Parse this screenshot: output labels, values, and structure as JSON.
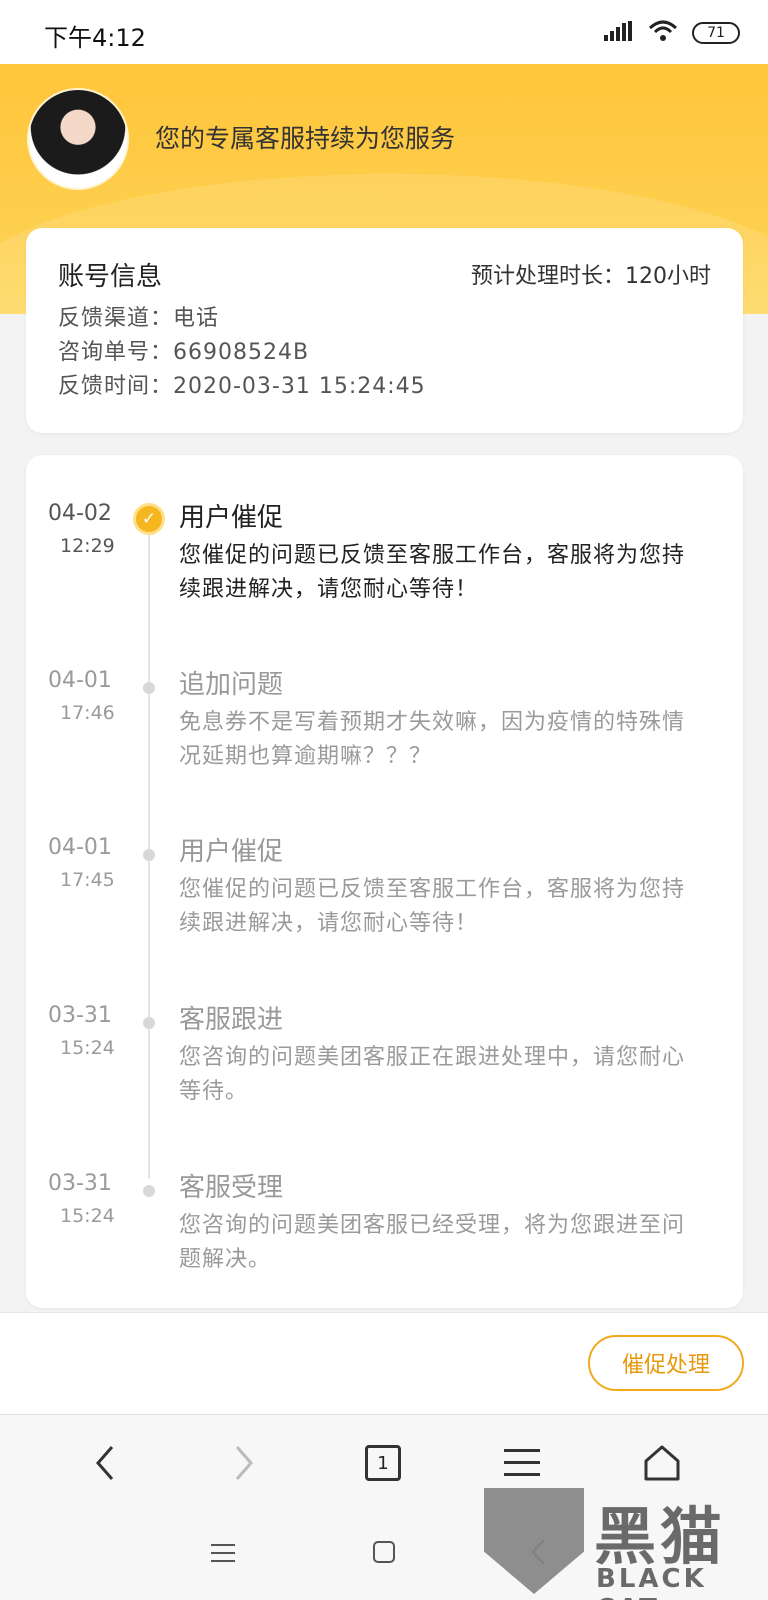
{
  "status_bar": {
    "time": "下午4:12",
    "battery": "71"
  },
  "header": {
    "title": "您的专属客服持续为您服务"
  },
  "account": {
    "title": "账号信息",
    "eta": "预计处理时长：120小时",
    "channel": "反馈渠道：电话",
    "ticket": "咨询单号：66908524B",
    "feedback_time": "反馈时间：2020-03-31 15:24:45"
  },
  "timeline": [
    {
      "date": "04-02",
      "time": "12:29",
      "title": "用户催促",
      "desc": "您催促的问题已反馈至客服工作台，客服将为您持续跟进解决，请您耐心等待！",
      "active": true
    },
    {
      "date": "04-01",
      "time": "17:46",
      "title": "追加问题",
      "desc": "免息券不是写着预期才失效嘛，因为疫情的特殊情况延期也算逾期嘛？？？",
      "active": false
    },
    {
      "date": "04-01",
      "time": "17:45",
      "title": "用户催促",
      "desc": "您催促的问题已反馈至客服工作台，客服将为您持续跟进解决，请您耐心等待！",
      "active": false
    },
    {
      "date": "03-31",
      "time": "15:24",
      "title": "客服跟进",
      "desc": "您咨询的问题美团客服正在跟进处理中，请您耐心等待。",
      "active": false
    },
    {
      "date": "03-31",
      "time": "15:24",
      "title": "客服受理",
      "desc": "您咨询的问题美团客服已经受理，将为您跟进至问题解决。",
      "active": false
    }
  ],
  "action": {
    "urge_label": "催促处理"
  },
  "browser": {
    "tab_count": "1"
  },
  "watermark": {
    "cn": "黑猫",
    "en": "BLACK CAT"
  },
  "colors": {
    "accent": "#f5b620",
    "header": "#ffc53b"
  }
}
